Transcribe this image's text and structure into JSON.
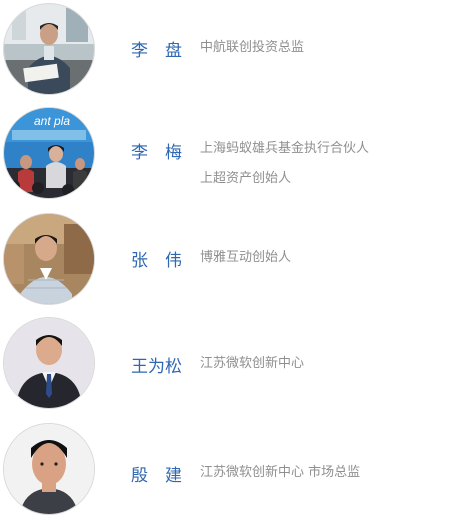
{
  "people": [
    {
      "name": "李　盘",
      "title_lines": [
        "中航联创投资总监"
      ],
      "avatar_icon": "person-at-desk-photo"
    },
    {
      "name": "李　梅",
      "title_lines": [
        "上海蚂蚁雄兵基金执行合伙人",
        "上超资产创始人"
      ],
      "avatar_icon": "person-on-stage-photo",
      "avatar_banner_text": "ant pla"
    },
    {
      "name": "张　伟",
      "title_lines": [
        "博雅互动创始人"
      ],
      "avatar_icon": "person-outdoor-photo"
    },
    {
      "name": "王为松",
      "title_lines": [
        "江苏微软创新中心"
      ],
      "avatar_icon": "person-in-suit-photo"
    },
    {
      "name": "殷　建",
      "title_lines": [
        "江苏微软创新中心  市场总监"
      ],
      "avatar_icon": "person-portrait-photo"
    }
  ]
}
